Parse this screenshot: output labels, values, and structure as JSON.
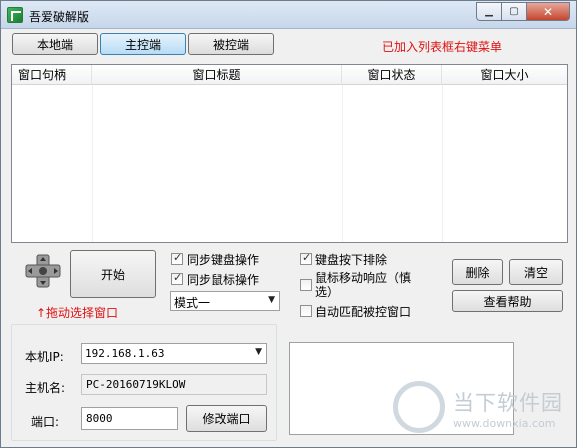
{
  "window": {
    "title": "吾爱破解版",
    "close_glyph": "✕",
    "min_glyph": "▁",
    "max_glyph": "▢"
  },
  "tabs": [
    {
      "label": "本地端",
      "active": false
    },
    {
      "label": "主控端",
      "active": true
    },
    {
      "label": "被控端",
      "active": false
    }
  ],
  "notice": "已加入列表框右键菜单",
  "list": {
    "columns": [
      "窗口句柄",
      "窗口标题",
      "窗口状态",
      "窗口大小"
    ],
    "rows": []
  },
  "controls": {
    "start_label": "开始",
    "drag_hint": "↑拖动选择窗口",
    "sync_keyboard": {
      "label": "同步键盘操作",
      "checked": true
    },
    "sync_mouse": {
      "label": "同步鼠标操作",
      "checked": true
    },
    "mode": {
      "value": "模式一"
    },
    "key_exclude": {
      "label": "键盘按下排除",
      "checked": true
    },
    "mouse_move": {
      "label": "鼠标移动响应（慎选）",
      "checked": false
    },
    "auto_match": {
      "label": "自动匹配被控窗口",
      "checked": false
    },
    "delete_label": "删除",
    "clear_label": "清空",
    "help_label": "查看帮助"
  },
  "network": {
    "ip_label": "本机IP:",
    "ip_value": "192.168.1.63",
    "host_label": "主机名:",
    "host_value": "PC-20160719KLOW",
    "port_label": "端口:",
    "port_value": "8000",
    "modify_port_label": "修改端口"
  },
  "watermark": {
    "text": "当下软件园",
    "url": "www.downxia.com"
  }
}
